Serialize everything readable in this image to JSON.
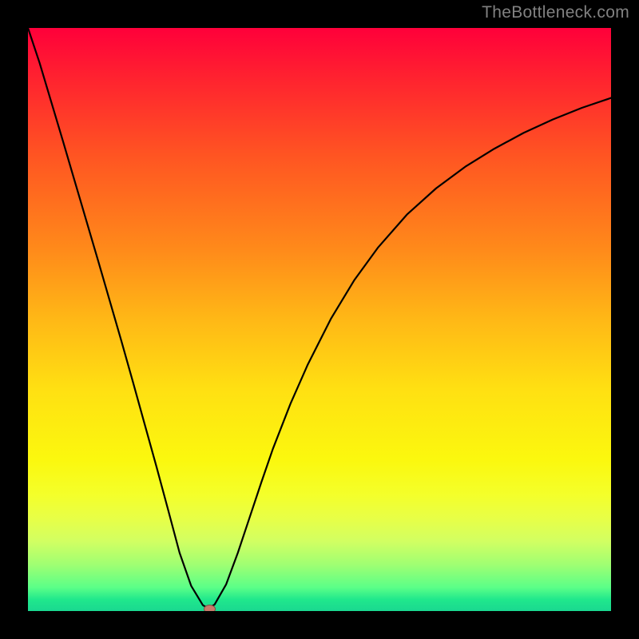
{
  "watermark": "TheBottleneck.com",
  "chart_data": {
    "type": "line",
    "xlim": [
      0,
      100
    ],
    "ylim": [
      0,
      100
    ],
    "x": [
      0,
      2,
      4,
      6,
      8,
      10,
      12,
      14,
      16,
      18,
      20,
      22,
      24,
      26,
      28,
      30,
      30.9,
      32,
      34,
      36,
      38,
      40,
      42,
      45,
      48,
      52,
      56,
      60,
      65,
      70,
      75,
      80,
      85,
      90,
      95,
      100
    ],
    "y": [
      100,
      94,
      87.3,
      80.6,
      73.8,
      67,
      60.2,
      53.3,
      46.4,
      39.3,
      32.1,
      24.9,
      17.5,
      10.0,
      4.3,
      1.0,
      0.5,
      1.1,
      4.6,
      10.0,
      16.0,
      22.0,
      27.8,
      35.5,
      42.3,
      50.2,
      56.8,
      62.3,
      68.0,
      72.5,
      76.2,
      79.3,
      82.0,
      84.3,
      86.3,
      88.0
    ],
    "series_name": "bottleneck-curve",
    "marker": {
      "x": 30.9,
      "y": 0.5
    }
  }
}
